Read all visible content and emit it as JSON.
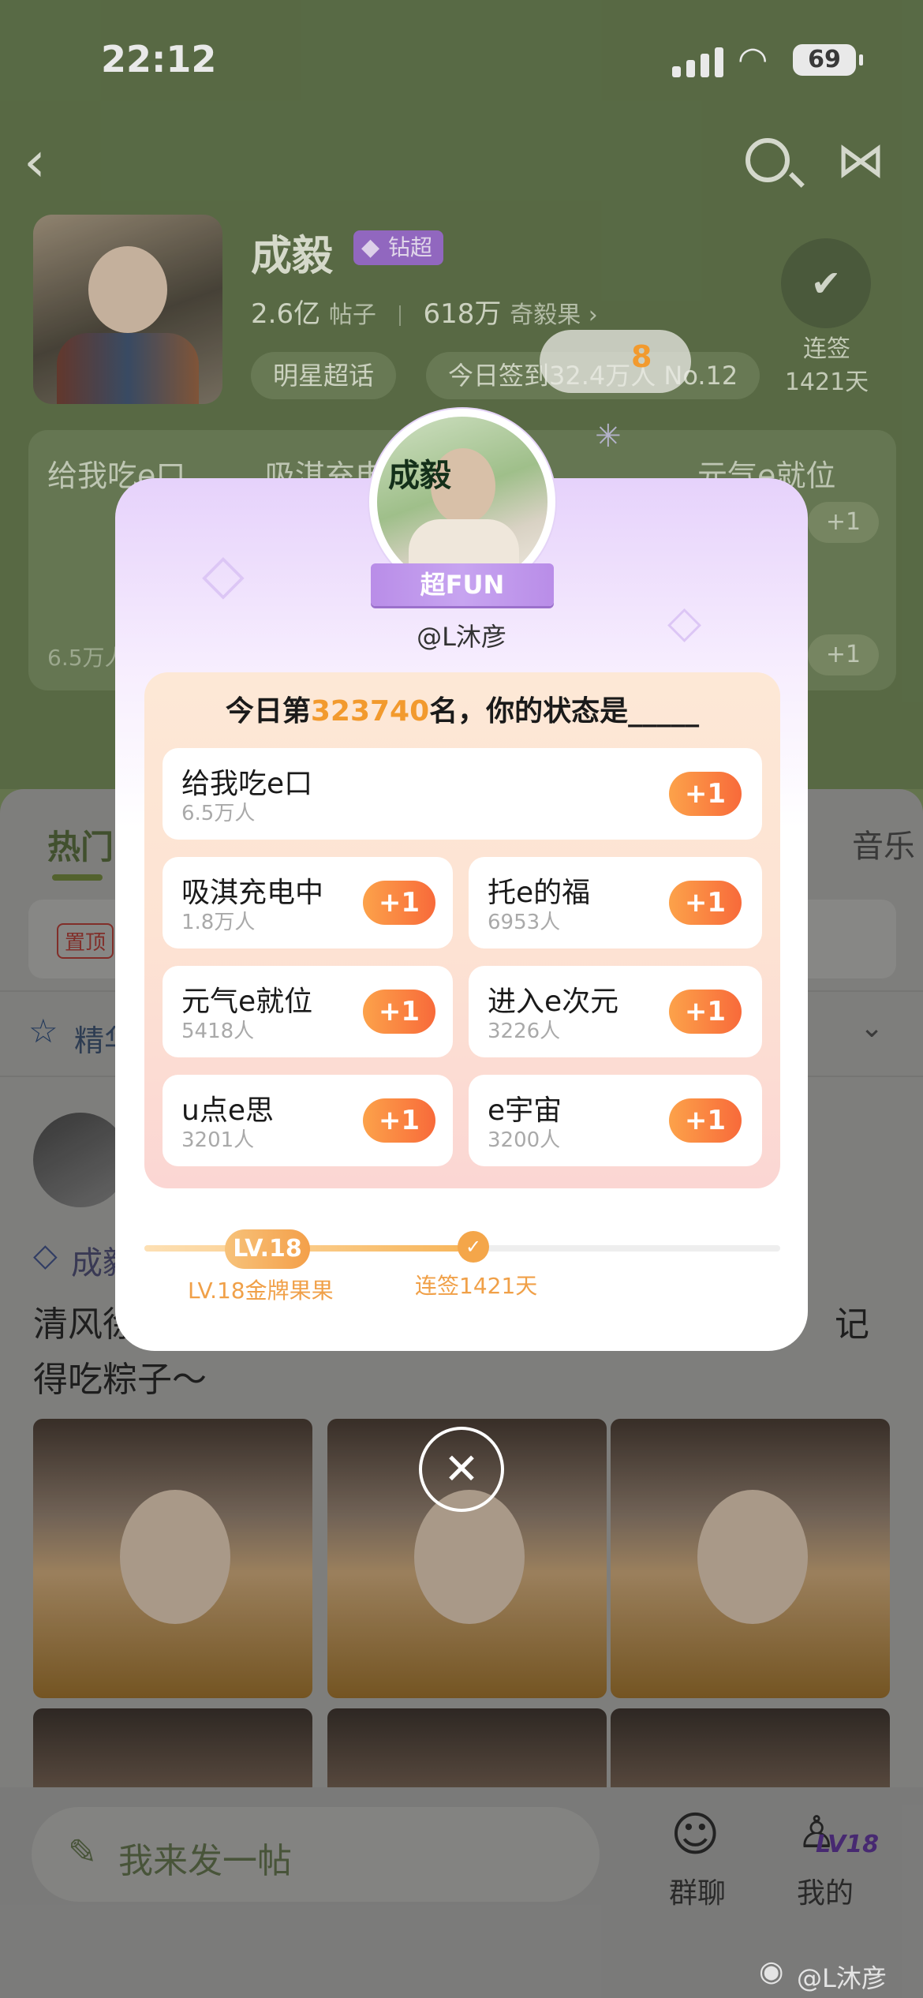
{
  "status_bar": {
    "time": "22:12",
    "battery": "69"
  },
  "header": {
    "star_name": "成毅",
    "badge": "钻超",
    "posts_count": "2.6亿",
    "posts_label": "帖子",
    "fans_count": "618万",
    "fans_label": "奇毅果 ›",
    "chips": [
      "明星超话",
      "今日签到32.4万人 No.12"
    ],
    "checkin_label": "连签",
    "checkin_days": "1421天"
  },
  "background_options": {
    "row1": [
      "给我吃e口",
      "吸淇充电中",
      "元气e就位"
    ],
    "count1": "6.5万人",
    "plus": "+1"
  },
  "tabs": {
    "hot": "热门",
    "music": "音乐"
  },
  "pinned_tag": "置顶",
  "featured": {
    "label": "精华"
  },
  "post": {
    "author_prefix": "成毅",
    "line1": "清风徐",
    "line1_end": "记",
    "line2": "得吃粽子～"
  },
  "bottom_bar": {
    "compose_placeholder": "我来发一帖",
    "group_chat": "群聊",
    "my": "我的",
    "my_level": "LV18"
  },
  "watermark": "@L沐彦",
  "toast": {
    "text": "8"
  },
  "popup": {
    "avatar_text": "成毅",
    "ribbon": "超FUN",
    "handle": "@L沐彦",
    "rank_prefix": "今日第",
    "rank_number": "323740",
    "rank_suffix": "名，你的状态是_____",
    "options": [
      {
        "title": "给我吃e口",
        "count": "6.5万人",
        "plus": "+1"
      },
      {
        "title": "吸淇充电中",
        "count": "1.8万人",
        "plus": "+1"
      },
      {
        "title": "托e的福",
        "count": "6953人",
        "plus": "+1"
      },
      {
        "title": "元气e就位",
        "count": "5418人",
        "plus": "+1"
      },
      {
        "title": "进入e次元",
        "count": "3226人",
        "plus": "+1"
      },
      {
        "title": "u点e思",
        "count": "3201人",
        "plus": "+1"
      },
      {
        "title": "e宇宙",
        "count": "3200人",
        "plus": "+1"
      }
    ],
    "level_badge": "LV.18",
    "level_label": "LV.18金牌果果",
    "streak_label": "连签1421天",
    "close_icon": "close-icon"
  },
  "colors": {
    "accent": "#f29a2e",
    "popup_purple": "#b98de8",
    "bg_green": "#5e7148"
  }
}
